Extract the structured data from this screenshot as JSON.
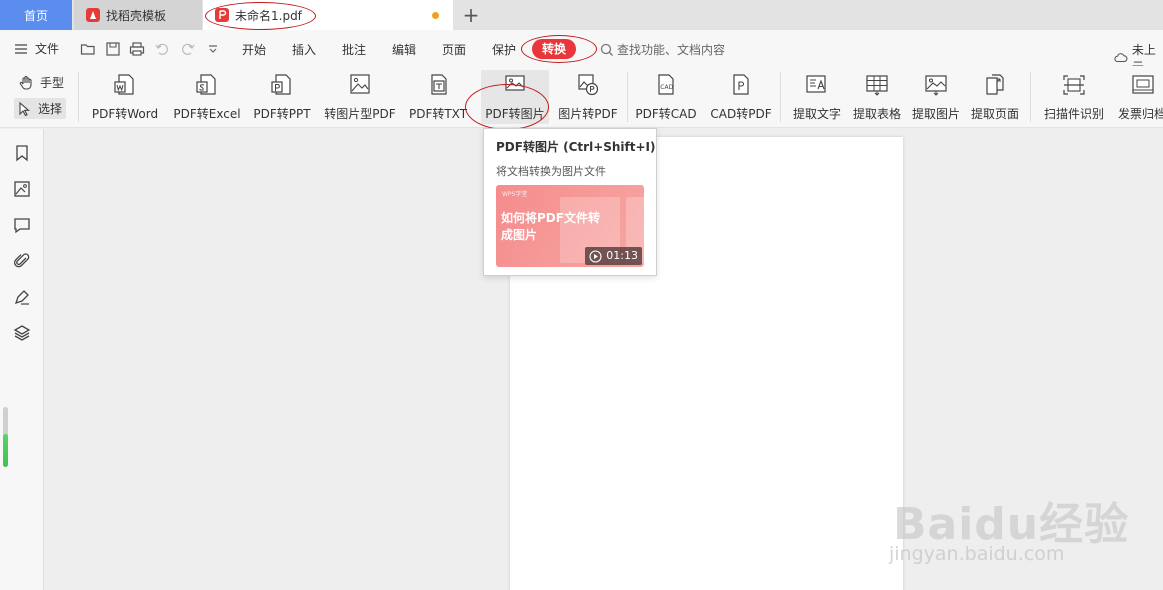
{
  "tabs": {
    "home": "首页",
    "template": "找稻壳模板",
    "document": "未命名1.pdf",
    "add": "+"
  },
  "menu": {
    "file": "文件",
    "items": [
      "开始",
      "插入",
      "批注",
      "编辑",
      "页面",
      "保护"
    ],
    "active": "转换",
    "search_placeholder": "查找功能、文档内容",
    "cloud": "未上云"
  },
  "modes": {
    "hand": "手型",
    "select": "选择"
  },
  "tools": [
    {
      "label": "PDF转Word",
      "icon": "pdf-to-word-icon"
    },
    {
      "label": "PDF转Excel",
      "icon": "pdf-to-excel-icon"
    },
    {
      "label": "PDF转PPT",
      "icon": "pdf-to-ppt-icon"
    },
    {
      "label": "转图片型PDF",
      "icon": "to-image-pdf-icon"
    },
    {
      "label": "PDF转TXT",
      "icon": "pdf-to-txt-icon"
    },
    {
      "label": "PDF转图片",
      "icon": "pdf-to-image-icon"
    },
    {
      "label": "图片转PDF",
      "icon": "image-to-pdf-icon"
    },
    {
      "label": "PDF转CAD",
      "icon": "pdf-to-cad-icon"
    },
    {
      "label": "CAD转PDF",
      "icon": "cad-to-pdf-icon"
    },
    {
      "label": "提取文字",
      "icon": "extract-text-icon"
    },
    {
      "label": "提取表格",
      "icon": "extract-table-icon"
    },
    {
      "label": "提取图片",
      "icon": "extract-image-icon"
    },
    {
      "label": "提取页面",
      "icon": "extract-page-icon"
    },
    {
      "label": "扫描件识别",
      "icon": "scan-recognize-icon"
    },
    {
      "label": "发票归档",
      "icon": "invoice-archive-icon"
    }
  ],
  "tooltip": {
    "title": "PDF转图片 (Ctrl+Shift+I)",
    "description": "将文档转换为图片文件",
    "video_brand": "WPS学堂",
    "video_text": "如何将PDF文件转成图片",
    "video_duration": "01:13"
  },
  "watermark": {
    "main": "Baidu经验",
    "sub": "jingyan.baidu.com"
  },
  "colors": {
    "accent_red": "#e8363a",
    "home_tab": "#5b8def",
    "progress_green": "#3cc451"
  }
}
